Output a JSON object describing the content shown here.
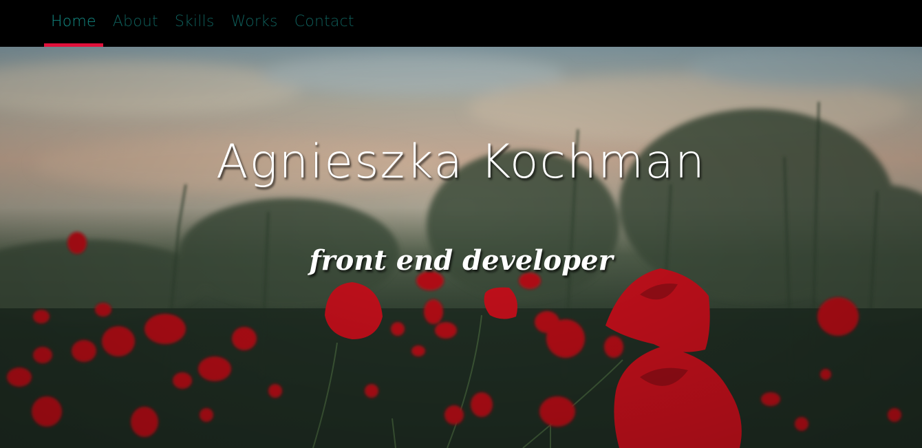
{
  "nav": {
    "items": [
      {
        "label": "Home",
        "active": true
      },
      {
        "label": "About",
        "active": false
      },
      {
        "label": "Skills",
        "active": false
      },
      {
        "label": "Works",
        "active": false
      },
      {
        "label": "Contact",
        "active": false
      }
    ],
    "accent_color": "#e0103a",
    "link_color": "#0f5f5b"
  },
  "hero": {
    "title": "Agnieszka Kochman",
    "subtitle": "front end developer",
    "background_image": "poppy-field-photo"
  }
}
